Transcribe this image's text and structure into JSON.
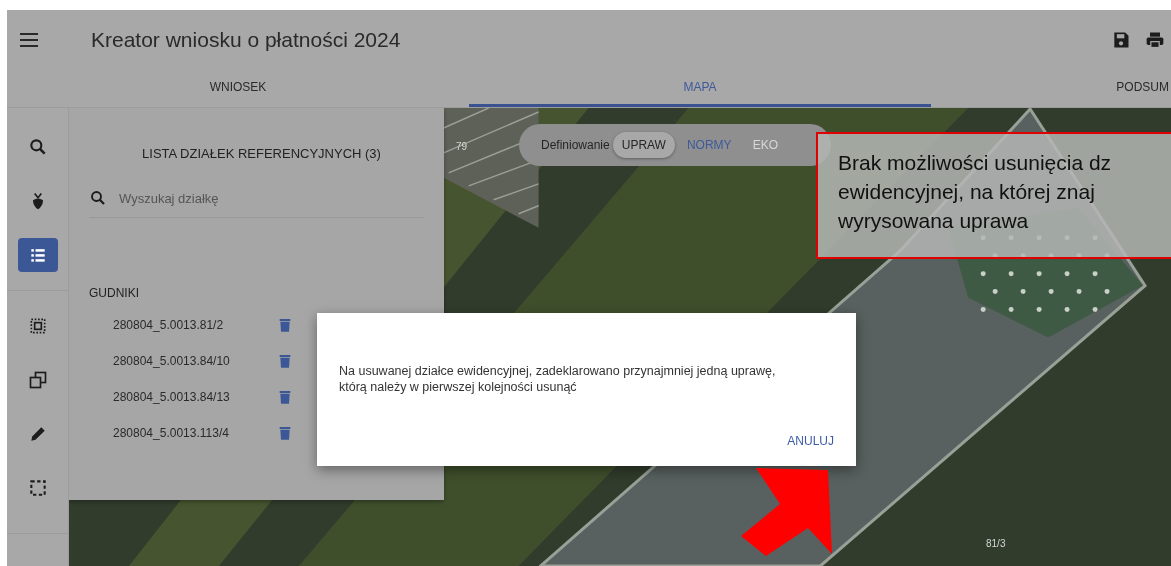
{
  "header": {
    "title": "Kreator wniosku o płatności 2024"
  },
  "tabs": [
    {
      "label": "WNIOSEK",
      "selected": false
    },
    {
      "label": "MAPA",
      "selected": true
    },
    {
      "label": "PODSUM",
      "selected": false
    }
  ],
  "rail": [
    {
      "selected": false
    },
    {
      "selected": false
    },
    {
      "selected": true
    },
    {
      "selected": false
    },
    {
      "selected": false
    },
    {
      "selected": false
    },
    {
      "selected": false
    }
  ],
  "parcel_list": {
    "title": "LISTA DZIAŁEK REFERENCYJNYCH (3)",
    "search": {
      "placeholder": "Wyszukaj działkę"
    },
    "group": "GUDNIKI",
    "items": [
      {
        "label": "280804_5.0013.81/2"
      },
      {
        "label": "280804_5.0013.84/10"
      },
      {
        "label": "280804_5.0013.84/13"
      },
      {
        "label": "280804_5.0013.113/4"
      }
    ]
  },
  "map": {
    "labels": [
      "79",
      "81/3"
    ]
  },
  "mode_toggle": {
    "label": "Definiowanie",
    "options": [
      {
        "label": "UPRAW",
        "selected": true,
        "disabled": false
      },
      {
        "label": "NORMY",
        "selected": false,
        "disabled": false
      },
      {
        "label": "EKO",
        "selected": false,
        "disabled": true
      }
    ]
  },
  "dialog": {
    "message": "Na usuwanej działce ewidencyjnej, zadeklarowano przynajmniej jedną uprawę, którą należy w pierwszej kolejności usunąć",
    "button": "ANULUJ"
  },
  "annotation": {
    "lines": [
      "Brak możliwości usunięcia dz",
      "ewidencyjnej, na której znaj",
      "wyrysowana uprawa"
    ]
  }
}
